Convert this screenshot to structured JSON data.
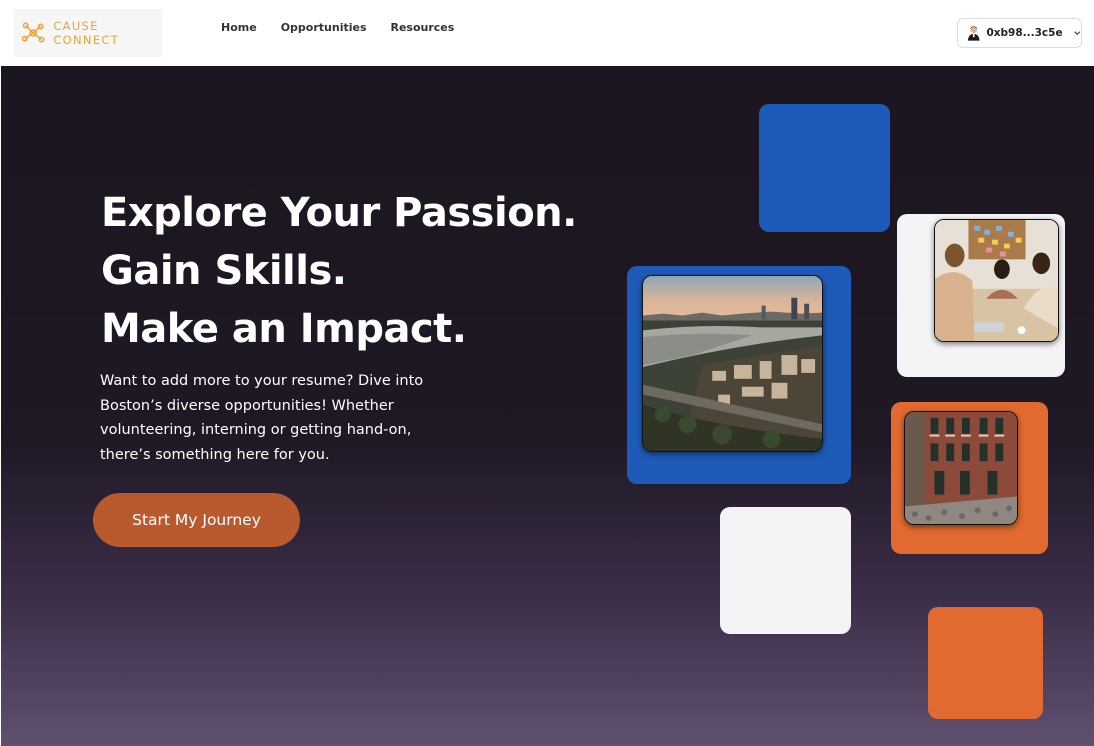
{
  "brand": {
    "name": "CAUSE CONNECT",
    "accent": "#e8a53a"
  },
  "nav": {
    "items": [
      "Home",
      "Opportunities",
      "Resources"
    ]
  },
  "wallet": {
    "address": "0xb98...3c5e",
    "icon": "chevron-down-icon"
  },
  "hero": {
    "headline": [
      "Explore Your Passion.",
      "Gain Skills.",
      "Make an Impact."
    ],
    "subtext": "Want to add more to your resume? Dive into Boston’s diverse opportunities! Whether volunteering, interning or getting hand-on, there’s something here for you.",
    "cta_label": "Start My Journey"
  },
  "colors": {
    "blue": "#1e5bb8",
    "orange": "#e06a2f",
    "cta": "#b8592e",
    "tile_white": "#f4f3f5"
  },
  "images": [
    "boston-skyline-photo",
    "team-meeting-photo",
    "brick-rowhouse-street-photo"
  ]
}
